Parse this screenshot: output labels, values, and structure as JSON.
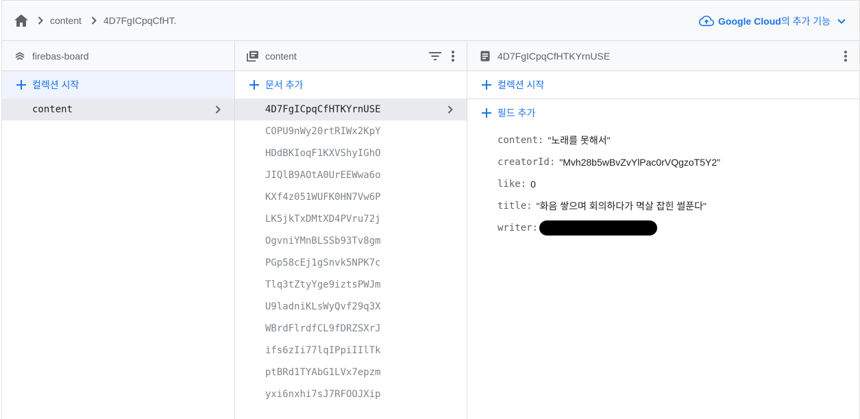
{
  "breadcrumb": {
    "items": [
      "content",
      "4D7FgICpqCfHT."
    ]
  },
  "google_cloud": {
    "label": "Google Cloud",
    "suffix": "의 추가 기능"
  },
  "columns": {
    "root": {
      "title": "firebas-board",
      "add_label": "컬렉션 시작",
      "collections": [
        "content"
      ]
    },
    "collection": {
      "title": "content",
      "add_label": "문서 추가",
      "documents": [
        "4D7FgICpqCfHTKYrnUSE",
        "COPU9nWy20rtRIWx2KpY",
        "HDdBKIoqF1KXVShyIGhO",
        "JIQlB9AOtA0UrEEWwa6o",
        "KXf4z051WUFK0HN7Vw6P",
        "LK5jkTxDMtXD4PVru72j",
        "OgvniYMnBLSSb93Tv8gm",
        "PGp58cEj1gSnvk5NPK7c",
        "Tlq3tZtyYge9iztsPWJm",
        "U9ladniKLsWyQvf29q3X",
        "WBrdFlrdfCL9fDRZSXrJ",
        "ifs6zIi77lqIPpiIIlTk",
        "ptBRd1TYAbG1LVx7epzm",
        "yxi6nxhi7sJ7RFOOJXip"
      ],
      "selected_index": 0
    },
    "document": {
      "title": "4D7FgICpqCfHTKYrnUSE",
      "add_collection_label": "컬렉션 시작",
      "add_field_label": "필드 추가",
      "fields": [
        {
          "key": "content:",
          "value": "\"노래를 못해서\""
        },
        {
          "key": "creatorId:",
          "value": "\"Mvh28b5wBvZvYlPac0rVQgzoT5Y2\""
        },
        {
          "key": "like:",
          "value": "0"
        },
        {
          "key": "title:",
          "value": "\"화음 쌓으며 회의하다가 멱살 잡힌 썰푼다\""
        },
        {
          "key": "writer:",
          "value": ""
        }
      ]
    }
  },
  "colors": {
    "accent": "#1a73e8",
    "selected_bg": "#e8eaed"
  }
}
